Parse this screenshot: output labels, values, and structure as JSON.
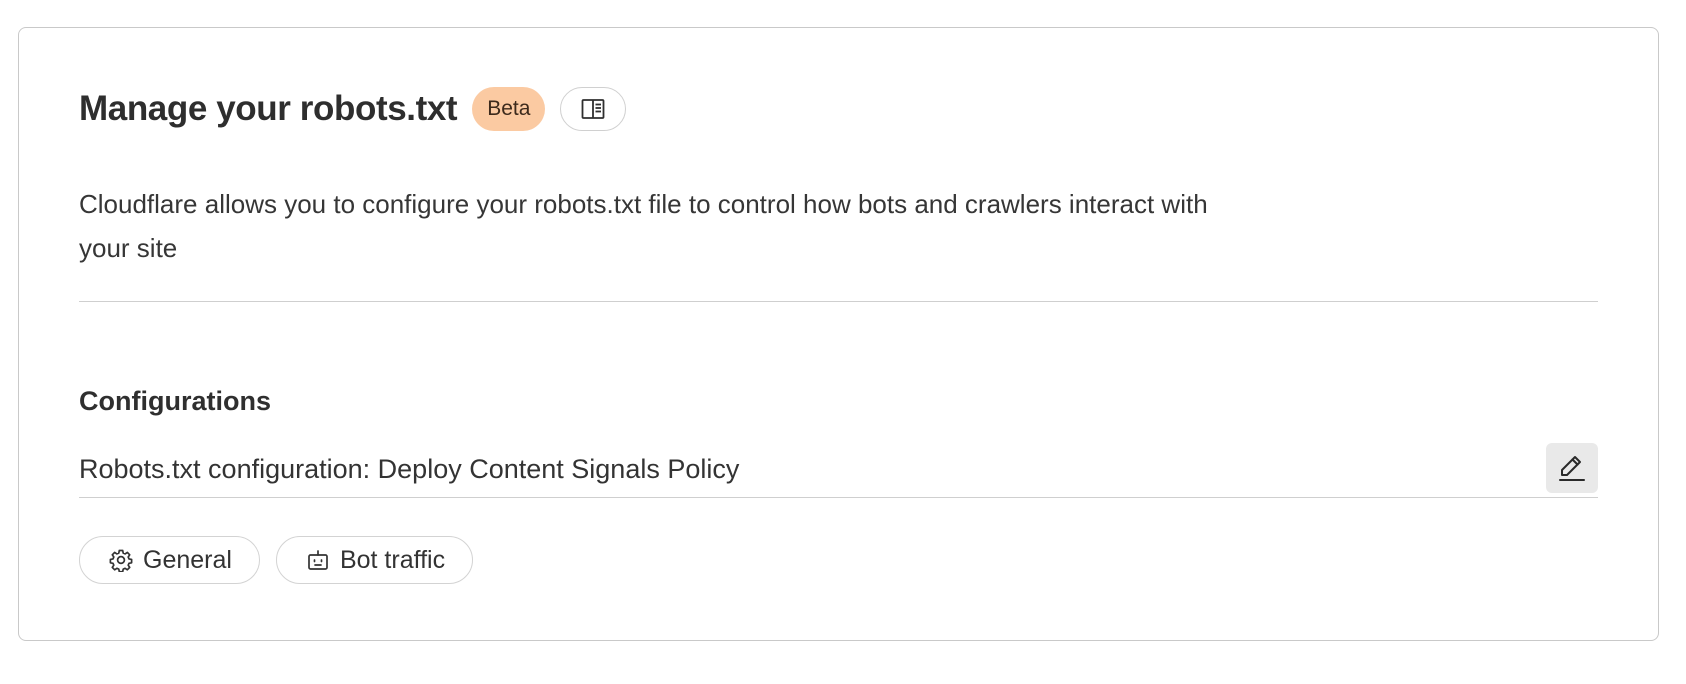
{
  "header": {
    "title": "Manage your robots.txt",
    "badge": "Beta",
    "docs_icon": "book-open-icon"
  },
  "description": "Cloudflare allows you to configure your robots.txt file to control how bots and crawlers interact with your site",
  "configurations": {
    "title": "Configurations",
    "item_text": "Robots.txt configuration: Deploy Content Signals Policy",
    "edit_icon": "pencil-icon"
  },
  "tags": [
    {
      "label": "General",
      "icon": "gear-icon"
    },
    {
      "label": "Bot traffic",
      "icon": "robot-icon"
    }
  ],
  "colors": {
    "badge_bg": "#fbcaa2",
    "edit_button_bg": "#e9e9e9",
    "border": "#c9c9c9"
  }
}
